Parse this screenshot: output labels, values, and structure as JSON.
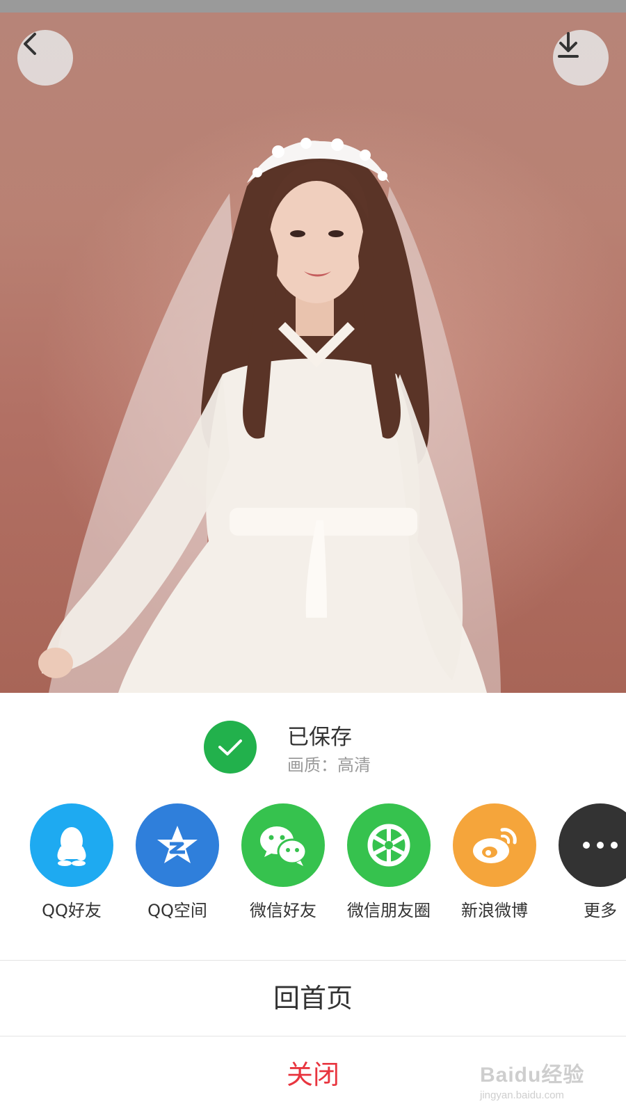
{
  "status": {
    "title": "已保存",
    "subtitle": "画质：高清"
  },
  "share": [
    {
      "label": "QQ好友",
      "color": "#1eaaf1",
      "icon": "qq-penguin-icon"
    },
    {
      "label": "QQ空间",
      "color": "#2f7fdb",
      "icon": "qzone-star-icon"
    },
    {
      "label": "微信好友",
      "color": "#36c24e",
      "icon": "wechat-icon"
    },
    {
      "label": "微信朋友圈",
      "color": "#36c24e",
      "icon": "moments-shutter-icon"
    },
    {
      "label": "新浪微博",
      "color": "#f5a53b",
      "icon": "weibo-icon"
    },
    {
      "label": "更多",
      "color": "#333333",
      "icon": "more-dots-icon"
    }
  ],
  "actions": {
    "home": "回首页",
    "close": "关闭"
  },
  "watermark": {
    "brand": "Baidu经验",
    "url": "jingyan.baidu.com"
  },
  "colors": {
    "accent_green": "#22b14c",
    "close_red": "#e8353f"
  }
}
